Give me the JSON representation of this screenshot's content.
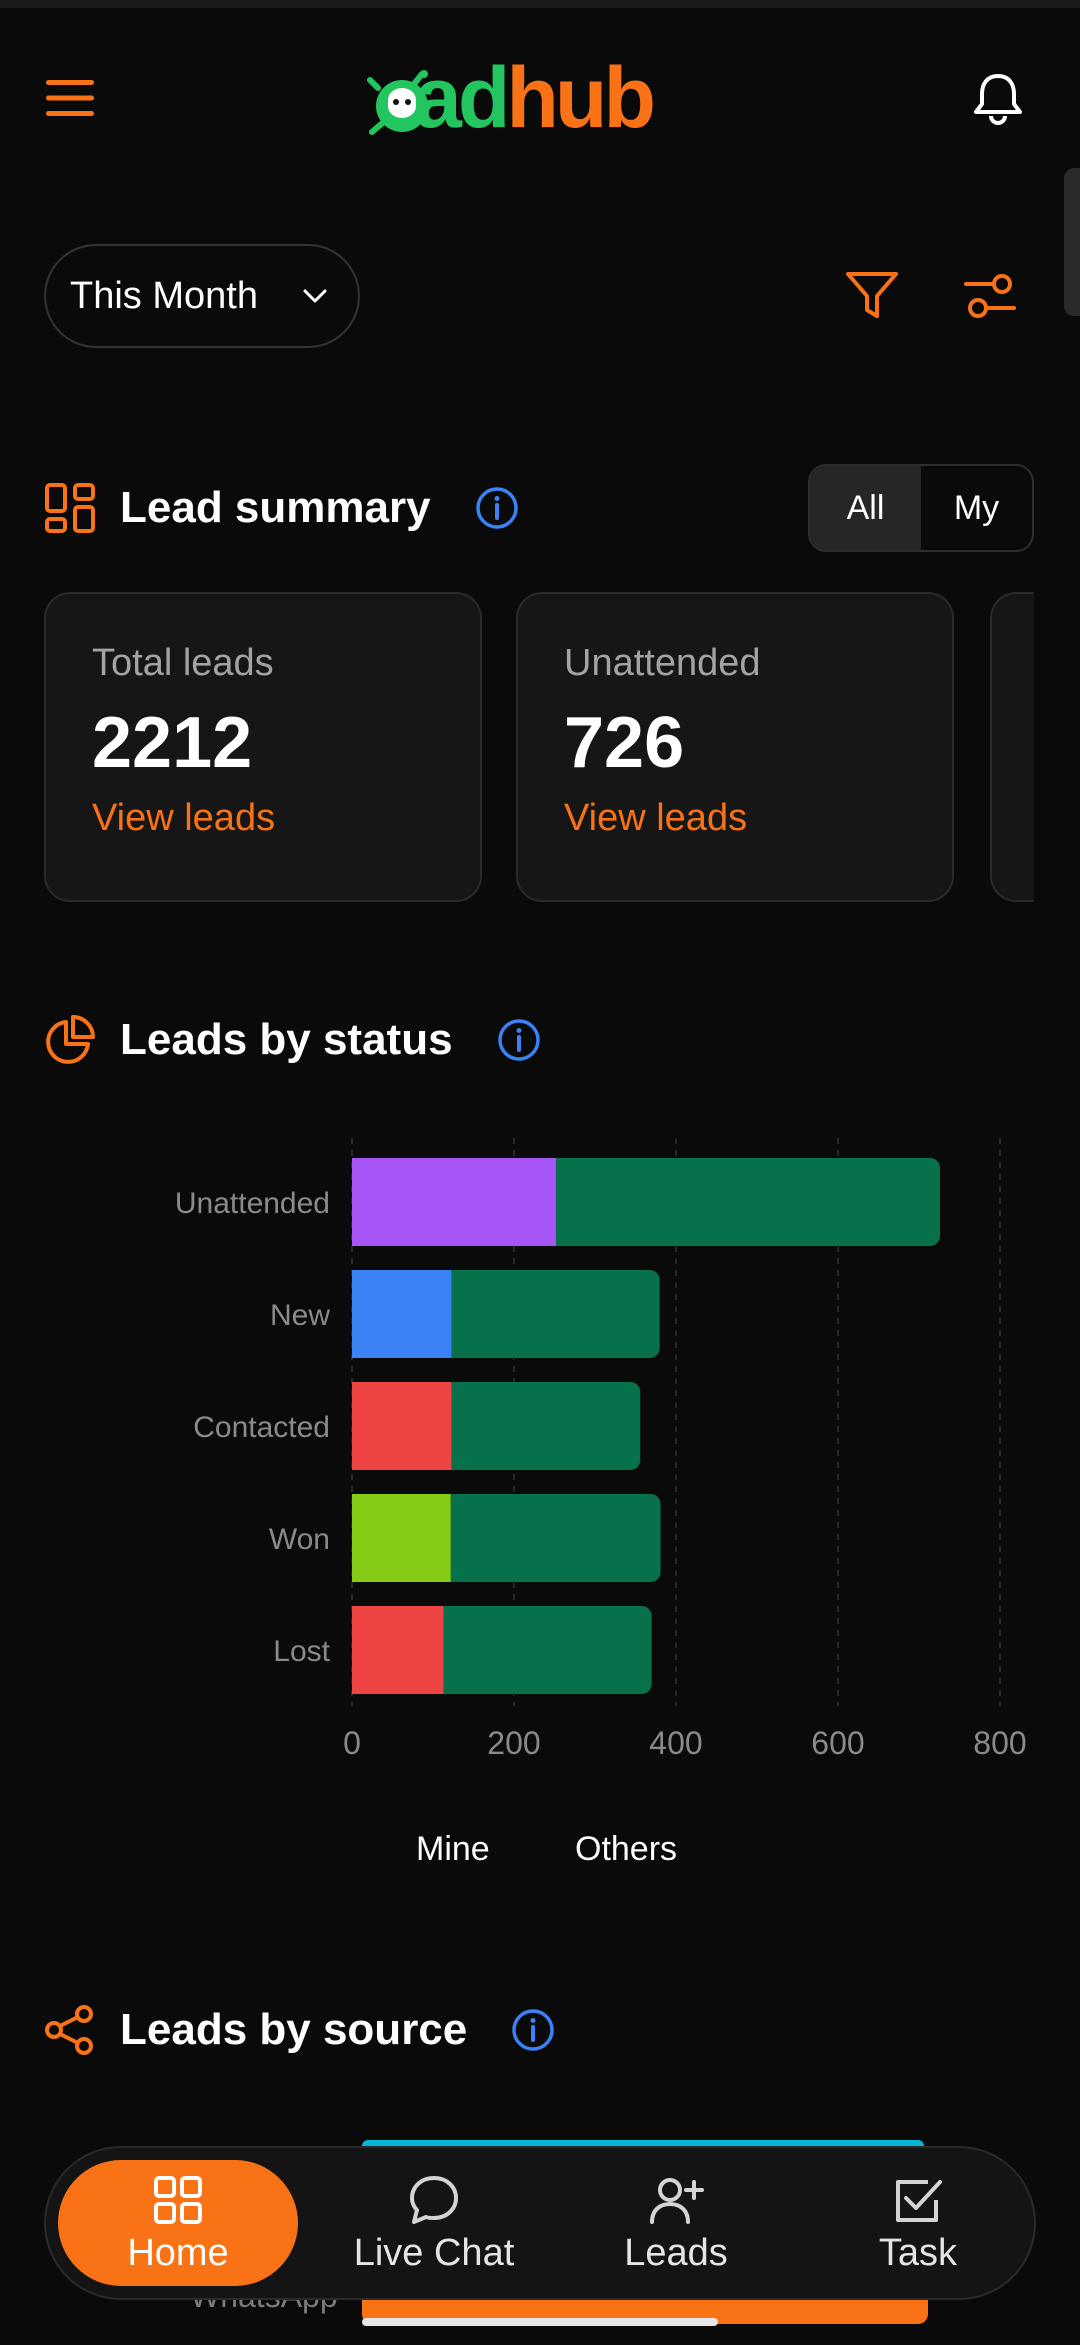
{
  "header": {
    "logo_prefix": "ad",
    "logo_suffix": "hub"
  },
  "filters": {
    "period": "This Month"
  },
  "lead_summary": {
    "title": "Lead summary",
    "toggle": [
      "All",
      "My"
    ],
    "active_toggle": "All",
    "cards": [
      {
        "label": "Total leads",
        "value": "2212",
        "link": "View leads"
      },
      {
        "label": "Unattended",
        "value": "726",
        "link": "View leads"
      }
    ]
  },
  "leads_by_status": {
    "title": "Leads by status"
  },
  "chart_data": {
    "type": "bar",
    "orientation": "horizontal",
    "stacked": true,
    "categories": [
      "Unattended",
      "New",
      "Contacted",
      "Won",
      "Lost"
    ],
    "series": [
      {
        "name": "Mine",
        "values": [
          252,
          123,
          123,
          122,
          113
        ],
        "colors": [
          "#a855f7",
          "#3b82f6",
          "#ef4444",
          "#84cc16",
          "#ef4444"
        ]
      },
      {
        "name": "Others",
        "values": [
          474,
          257,
          233,
          259,
          257
        ],
        "color": "#06714a"
      }
    ],
    "xlim": [
      0,
      800
    ],
    "xticks": [
      0,
      200,
      400,
      600,
      800
    ],
    "grid": true,
    "legend": "bottom-center"
  },
  "leads_by_source": {
    "title": "Leads by source",
    "first_label": "WhatsApp"
  },
  "colors": {
    "accent": "#f97316",
    "brand_green": "#22c55e",
    "info": "#3b82f6",
    "background": "#0a0a0a"
  },
  "nav": [
    {
      "label": "Home",
      "icon": "grid-icon",
      "active": true
    },
    {
      "label": "Live Chat",
      "icon": "chat-bubble-icon",
      "active": false
    },
    {
      "label": "Leads",
      "icon": "user-plus-icon",
      "active": false
    },
    {
      "label": "Task",
      "icon": "checkbox-icon",
      "active": false
    }
  ]
}
